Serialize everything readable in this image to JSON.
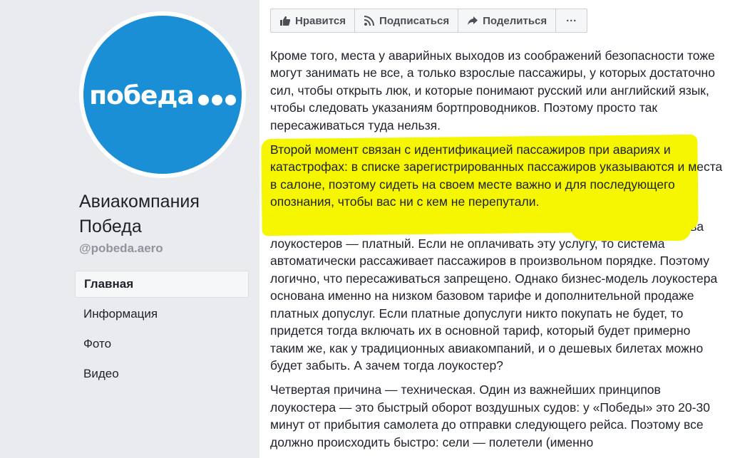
{
  "logo": {
    "text": "победа",
    "bg_color": "#1a8fd6"
  },
  "page": {
    "name": "Авиакомпания Победа",
    "handle": "@pobeda.aero"
  },
  "nav": {
    "items": [
      {
        "label": "Главная",
        "active": true
      },
      {
        "label": "Информация",
        "active": false
      },
      {
        "label": "Фото",
        "active": false
      },
      {
        "label": "Видео",
        "active": false
      }
    ]
  },
  "toolbar": {
    "like_label": "Нравится",
    "subscribe_label": "Подписаться",
    "share_label": "Поделиться",
    "more_label": "···"
  },
  "post": {
    "paragraphs": [
      "Кроме того, места у аварийных выходов из соображений безопасности тоже могут занимать не все, а только взрослые пассажиры, у которых достаточно сил, чтобы открыть люк, и которые понимают русский или английский язык, чтобы следовать указаниям бортпроводников. Поэтому просто так пересаживаться туда нельзя.",
      "Второй момент связан с идентификацией пассажиров при авариях и катастрофах: в списке зарегистрированных пассажиров указываются и места в салоне, поэтому сидеть на своем месте важно и для последующего опознания, чтобы вас ни с кем не перепутали.",
      "Третья причина — маркетинговая. Выбор места в самолетах большинства лоукостеров — платный. Если не оплачивать эту услугу, то система автоматически рассаживает пассажиров в произвольном порядке. Поэтому логично, что пересаживаться запрещено. Однако бизнес-модель лоукостера основана именно на низком базовом тарифе и дополнительной продаже платных допуслуг. Если платные допуслуги никто покупать не будет, то придется тогда включать их в основной тариф, который будет примерно таким же, как у традиционных авиакомпаний, и о дешевых билетах можно будет забыть. А зачем тогда лоукостер?",
      "Четвертая причина — техническая. Один из важнейших принципов лоукостера — это быстрый оборот воздушных судов: у «Победы» это 20-30 минут от прибытия самолета до отправки следующего рейса. Поэтому все должно происходить быстро: сели — полетели (именно"
    ],
    "highlight_color": "#f6f600"
  }
}
